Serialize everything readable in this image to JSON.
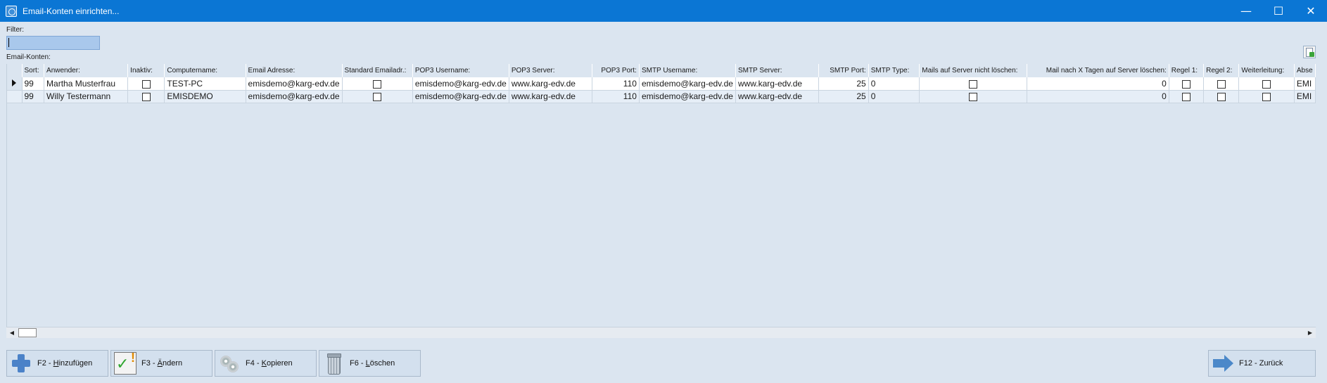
{
  "window": {
    "title": "Email-Konten einrichten...",
    "minimize_glyph": "—",
    "maximize_glyph": "☐",
    "close_glyph": "✕"
  },
  "filter": {
    "label": "Filter:",
    "value": ""
  },
  "grid": {
    "label": "Email-Konten:",
    "columns": [
      "Sort:",
      "Anwender:",
      "Inaktiv:",
      "Computername:",
      "Email Adresse:",
      "Standard Emailadr.:",
      "POP3 Username:",
      "POP3 Server:",
      "POP3 Port:",
      "SMTP Username:",
      "SMTP Server:",
      "SMTP Port:",
      "SMTP Type:",
      "Mails auf Server nicht löschen:",
      "Mail nach X Tagen auf Server löschen:",
      "Regel 1:",
      "Regel 2:",
      "Weiterleitung:",
      "Abse"
    ],
    "rows": [
      {
        "sort": "99",
        "user": "Martha Musterfrau",
        "inactive": false,
        "computer": "TEST-PC",
        "email": "emisdemo@karg-edv.de",
        "standard": false,
        "pop3_user": "emisdemo@karg-edv.de",
        "pop3_server": "www.karg-edv.de",
        "pop3_port": "110",
        "smtp_user": "emisdemo@karg-edv.de",
        "smtp_server": "www.karg-edv.de",
        "smtp_port": "25",
        "smtp_type": "0",
        "keep_on_server": false,
        "delete_after_days": "0",
        "rule1": false,
        "rule2": false,
        "forward": false,
        "sender": "EMI"
      },
      {
        "sort": "99",
        "user": "Willy Testermann",
        "inactive": false,
        "computer": "EMISDEMO",
        "email": "emisdemo@karg-edv.de",
        "standard": false,
        "pop3_user": "emisdemo@karg-edv.de",
        "pop3_server": "www.karg-edv.de",
        "pop3_port": "110",
        "smtp_user": "emisdemo@karg-edv.de",
        "smtp_server": "www.karg-edv.de",
        "smtp_port": "25",
        "smtp_type": "0",
        "keep_on_server": false,
        "delete_after_days": "0",
        "rule1": false,
        "rule2": false,
        "forward": false,
        "sender": "EMI"
      }
    ]
  },
  "buttons": {
    "add": {
      "prefix": "F2 - ",
      "mnemonic": "H",
      "rest": "inzufügen",
      "icon": "plus-icon"
    },
    "edit": {
      "prefix": "F3 - ",
      "mnemonic": "Ä",
      "rest": "ndern",
      "icon": "edit-check-icon"
    },
    "copy": {
      "prefix": "F4 - ",
      "mnemonic": "K",
      "rest": "opieren",
      "icon": "copy-discs-icon"
    },
    "delete": {
      "prefix": "F6 - ",
      "mnemonic": "L",
      "rest": "öschen",
      "icon": "trash-icon"
    },
    "back": {
      "label": "F12 - Zurück",
      "icon": "arrow-right-icon"
    }
  },
  "colors": {
    "titlebar": "#0b76d4",
    "window_bg": "#dbe5f0",
    "filter_input": "#a9c8ec",
    "button_bg": "#d3e0ee"
  }
}
